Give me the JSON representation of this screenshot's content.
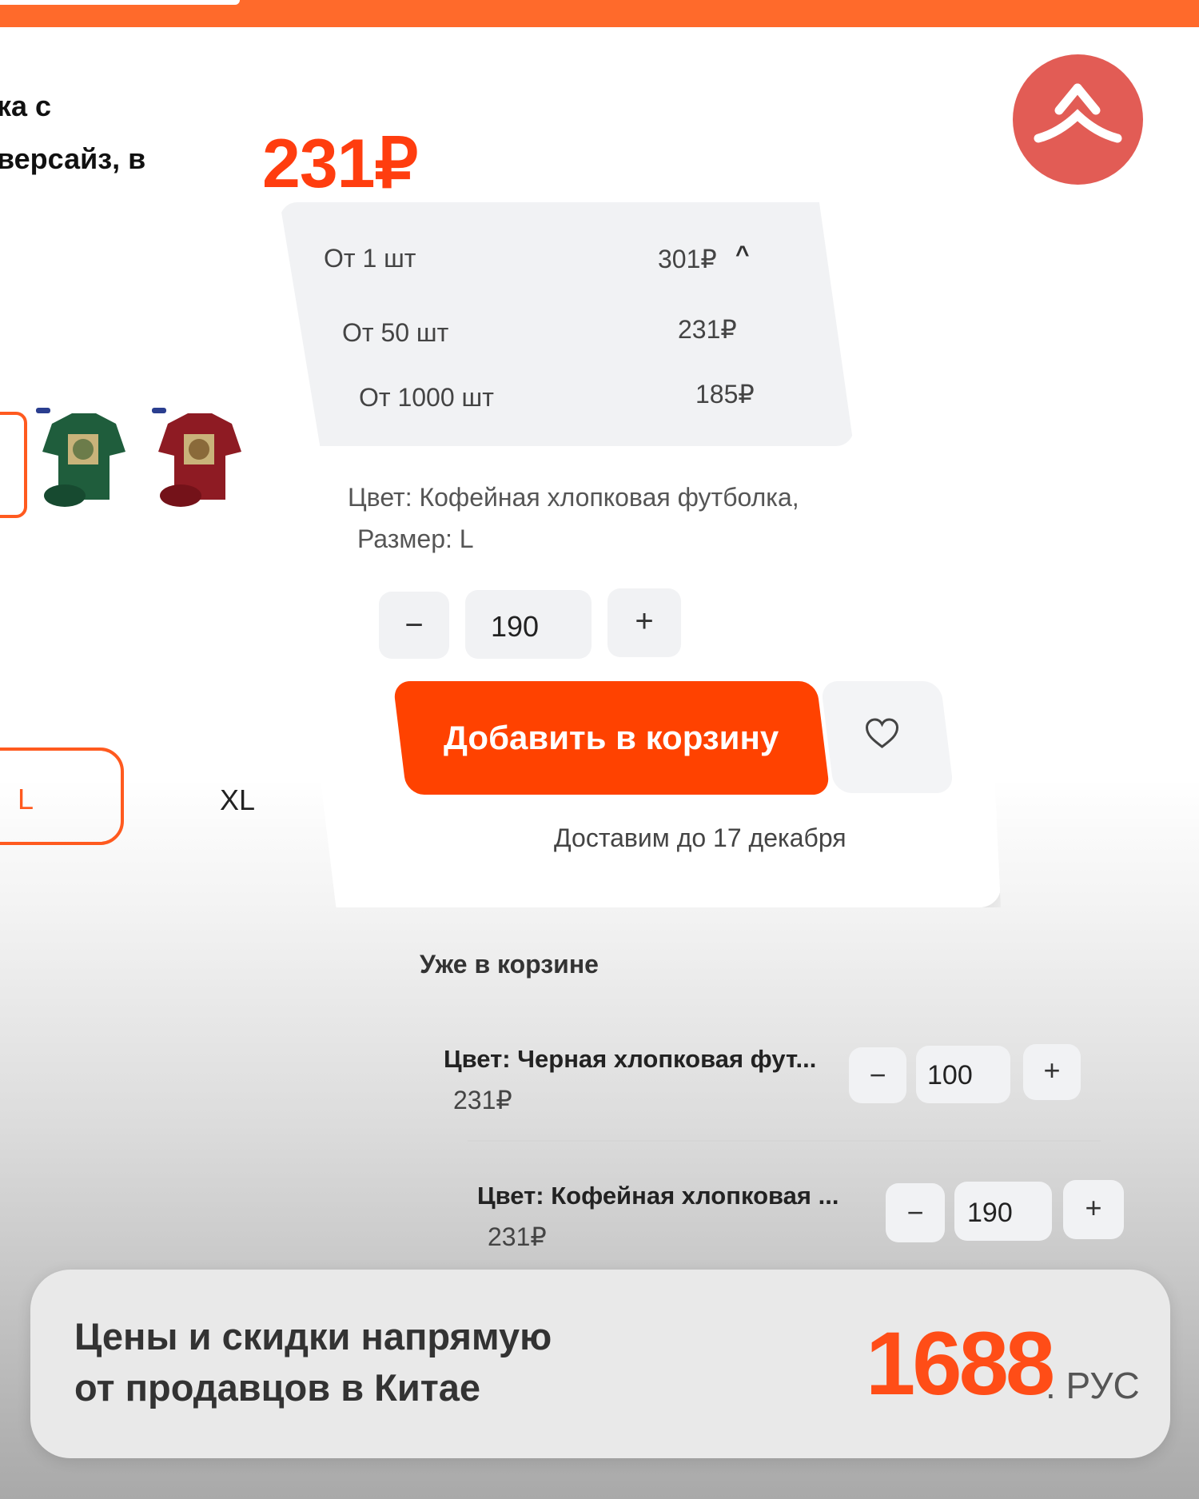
{
  "product": {
    "title_lines": [
      "ка с",
      "версайз, в"
    ],
    "sizes": {
      "selected": "L",
      "other": "XL"
    }
  },
  "offer": {
    "price": "231₽",
    "tiers": [
      {
        "label": "От 1 шт",
        "price": "301₽"
      },
      {
        "label": "От 50 шт",
        "price": "231₽"
      },
      {
        "label": "От 1000 шт",
        "price": "185₽"
      }
    ],
    "variant_line1": "Цвет: Кофейная хлопковая футболка,",
    "variant_line2": "Размер: L",
    "quantity": "190",
    "minus": "−",
    "plus": "+",
    "add_to_cart_label": "Добавить в корзину",
    "delivery": "Доставим до 17 декабря"
  },
  "cart": {
    "title": "Уже в корзине",
    "items": [
      {
        "name": "Цвет: Черная хлопковая фут...",
        "price": "231₽",
        "quantity": "100"
      },
      {
        "name": "Цвет: Кофейная хлопковая ...",
        "price": "231₽",
        "quantity": "190"
      }
    ]
  },
  "banner": {
    "line1": "Цены и скидки напрямую",
    "line2": "от продавцов в Китае",
    "brand_number": "1688",
    "brand_suffix": ". РУС"
  },
  "colors": {
    "accent": "#ff4200",
    "price": "#ff3d0f",
    "logo_circle": "#e25c55"
  },
  "icons": [
    "chevron-up-icon",
    "heart-icon",
    "logo-icon"
  ]
}
